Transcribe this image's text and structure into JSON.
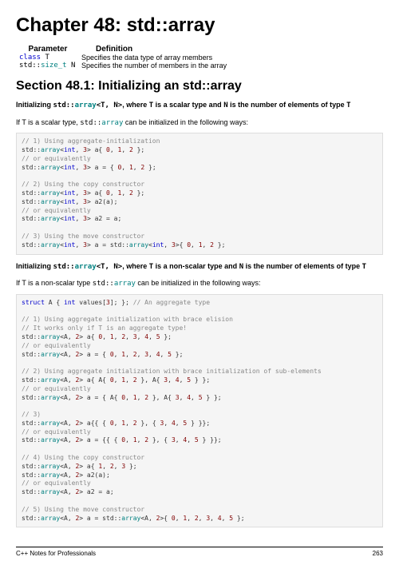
{
  "chapter_title": "Chapter 48: std::array",
  "table": {
    "header_param": "Parameter",
    "header_def": "Definition",
    "row1_param_kw": "class",
    "row1_param_t": " T",
    "row1_def": "Specifies the data type of array members",
    "row2_param_pre": "std::",
    "row2_param_type": "size_t",
    "row2_param_post": " N",
    "row2_def": "Specifies the number of members in the array"
  },
  "section_title": "Section 48.1: Initializing an std::array",
  "para1_pre": "Initializing ",
  "para1_code_pre": "std::",
  "para1_code_arr": "array",
  "para1_code_post": "<T,  N>",
  "para1_mid": ", where ",
  "para1_t": "T",
  "para1_mid2": " is a scalar type and ",
  "para1_n": "N",
  "para1_mid3": " is the number of elements of type ",
  "para1_t2": "T",
  "para2_pre": "If T is a scalar type, ",
  "para2_code_pre": "std::",
  "para2_code_arr": "array",
  "para2_post": " can be initialized in the following ways:",
  "code1": {
    "l1": "// 1) Using aggregate-initialization",
    "l2a": "std::",
    "l2b": "array",
    "l2c": "<",
    "l2d": "int",
    "l2e": ", ",
    "l2f": "3",
    "l2g": "> a{ ",
    "l2h": "0",
    "l2i": ", ",
    "l2j": "1",
    "l2k": ", ",
    "l2l": "2",
    "l2m": " };",
    "l3": "// or equivalently",
    "l4a": "std::",
    "l4b": "array",
    "l4c": "<",
    "l4d": "int",
    "l4e": ", ",
    "l4f": "3",
    "l4g": "> a = { ",
    "l4h": "0",
    "l4i": ", ",
    "l4j": "1",
    "l4k": ", ",
    "l4l": "2",
    "l4m": " };",
    "l5": "",
    "l6": "// 2) Using the copy constructor",
    "l7a": "std::",
    "l7b": "array",
    "l7c": "<",
    "l7d": "int",
    "l7e": ", ",
    "l7f": "3",
    "l7g": "> a{ ",
    "l7h": "0",
    "l7i": ", ",
    "l7j": "1",
    "l7k": ", ",
    "l7l": "2",
    "l7m": " };",
    "l8a": "std::",
    "l8b": "array",
    "l8c": "<",
    "l8d": "int",
    "l8e": ", ",
    "l8f": "3",
    "l8g": "> a2(a);",
    "l9": "// or equivalently",
    "l10a": "std::",
    "l10b": "array",
    "l10c": "<",
    "l10d": "int",
    "l10e": ", ",
    "l10f": "3",
    "l10g": "> a2 = a;",
    "l11": "",
    "l12": "// 3) Using the move constructor",
    "l13a": "std::",
    "l13b": "array",
    "l13c": "<",
    "l13d": "int",
    "l13e": ", ",
    "l13f": "3",
    "l13g": "> a = std::",
    "l13h": "array",
    "l13i": "<",
    "l13j": "int",
    "l13k": ", ",
    "l13l": "3",
    "l13m": ">{ ",
    "l13n": "0",
    "l13o": ", ",
    "l13p": "1",
    "l13q": ", ",
    "l13r": "2",
    "l13s": " };"
  },
  "para3_pre": "Initializing ",
  "para3_code_pre": "std::",
  "para3_code_arr": "array",
  "para3_code_post": "<T,  N>",
  "para3_mid": ", where ",
  "para3_t": "T",
  "para3_mid2": " is a non-scalar type and ",
  "para3_n": "N",
  "para3_mid3": " is the number of elements of type ",
  "para3_t2": "T",
  "para4_pre": "If T is a non-scalar type ",
  "para4_code_pre": "std::",
  "para4_code_arr": "array",
  "para4_post": " can be initialized in the following ways:",
  "code2": {
    "s1a": "struct",
    "s1b": " A { ",
    "s1c": "int",
    "s1d": " values[",
    "s1e": "3",
    "s1f": "]; }; ",
    "s1g": "// An aggregate type",
    "b1": "",
    "c1": "// 1) Using aggregate initialization with brace elision",
    "c2": "// It works only if T is an aggregate type!",
    "l1a": "std::",
    "l1b": "array",
    "l1c": "<A, ",
    "l1d": "2",
    "l1e": "> a{ ",
    "l1f": "0",
    "l1g": ", ",
    "l1h": "1",
    "l1i": ", ",
    "l1j": "2",
    "l1k": ", ",
    "l1l": "3",
    "l1m": ", ",
    "l1n": "4",
    "l1o": ", ",
    "l1p": "5",
    "l1q": " };",
    "c3": "// or equivalently",
    "l2a": "std::",
    "l2b": "array",
    "l2c": "<A, ",
    "l2d": "2",
    "l2e": "> a = { ",
    "l2f": "0",
    "l2g": ", ",
    "l2h": "1",
    "l2i": ", ",
    "l2j": "2",
    "l2k": ", ",
    "l2l": "3",
    "l2m": ", ",
    "l2n": "4",
    "l2o": ", ",
    "l2p": "5",
    "l2q": " };",
    "b2": "",
    "c4": "// 2) Using aggregate initialization with brace initialization of sub-elements",
    "l3a": "std::",
    "l3b": "array",
    "l3c": "<A, ",
    "l3d": "2",
    "l3e": "> a{ A{ ",
    "l3f": "0",
    "l3g": ", ",
    "l3h": "1",
    "l3i": ", ",
    "l3j": "2",
    "l3k": " }, A{ ",
    "l3l": "3",
    "l3m": ", ",
    "l3n": "4",
    "l3o": ", ",
    "l3p": "5",
    "l3q": " } };",
    "c5": "// or equivalently",
    "l4a": "std::",
    "l4b": "array",
    "l4c": "<A, ",
    "l4d": "2",
    "l4e": "> a = { A{ ",
    "l4f": "0",
    "l4g": ", ",
    "l4h": "1",
    "l4i": ", ",
    "l4j": "2",
    "l4k": " }, A{ ",
    "l4l": "3",
    "l4m": ", ",
    "l4n": "4",
    "l4o": ", ",
    "l4p": "5",
    "l4q": " } };",
    "b3": "",
    "c6": "// 3)",
    "l5a": "std::",
    "l5b": "array",
    "l5c": "<A, ",
    "l5d": "2",
    "l5e": "> a{{ { ",
    "l5f": "0",
    "l5g": ", ",
    "l5h": "1",
    "l5i": ", ",
    "l5j": "2",
    "l5k": " }, { ",
    "l5l": "3",
    "l5m": ", ",
    "l5n": "4",
    "l5o": ", ",
    "l5p": "5",
    "l5q": " } }};",
    "c7": "// or equivalently",
    "l6a": "std::",
    "l6b": "array",
    "l6c": "<A, ",
    "l6d": "2",
    "l6e": "> a = {{ { ",
    "l6f": "0",
    "l6g": ", ",
    "l6h": "1",
    "l6i": ", ",
    "l6j": "2",
    "l6k": " }, { ",
    "l6l": "3",
    "l6m": ", ",
    "l6n": "4",
    "l6o": ", ",
    "l6p": "5",
    "l6q": " } }};",
    "b4": "",
    "c8": "// 4) Using the copy constructor",
    "l7a": "std::",
    "l7b": "array",
    "l7c": "<A, ",
    "l7d": "2",
    "l7e": "> a{ ",
    "l7f": "1",
    "l7g": ", ",
    "l7h": "2",
    "l7i": ", ",
    "l7j": "3",
    "l7k": " };",
    "l8a": "std::",
    "l8b": "array",
    "l8c": "<A, ",
    "l8d": "2",
    "l8e": "> a2(a);",
    "c9": "// or equivalently",
    "l9a": "std::",
    "l9b": "array",
    "l9c": "<A, ",
    "l9d": "2",
    "l9e": "> a2 = a;",
    "b5": "",
    "c10": "// 5) Using the move constructor",
    "l10a": "std::",
    "l10b": "array",
    "l10c": "<A, ",
    "l10d": "2",
    "l10e": "> a = std::",
    "l10f": "array",
    "l10g": "<A, ",
    "l10h": "2",
    "l10i": ">{ ",
    "l10j": "0",
    "l10k": ", ",
    "l10l": "1",
    "l10m": ", ",
    "l10n": "2",
    "l10o": ", ",
    "l10p": "3",
    "l10q": ", ",
    "l10r": "4",
    "l10s": ", ",
    "l10t": "5",
    "l10u": " };"
  },
  "footer_left": "C++ Notes for Professionals",
  "footer_right": "263"
}
